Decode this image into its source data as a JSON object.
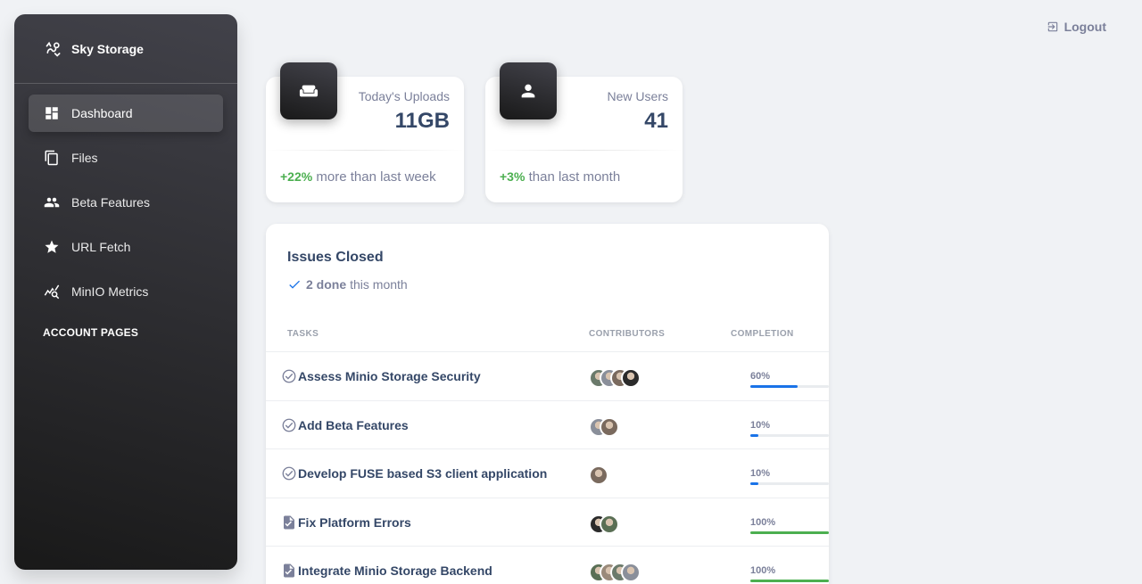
{
  "brand": {
    "name": "Sky Storage"
  },
  "sidebar": {
    "items": [
      {
        "label": "Dashboard",
        "icon": "dashboard-icon",
        "active": true
      },
      {
        "label": "Files",
        "icon": "files-icon",
        "active": false
      },
      {
        "label": "Beta Features",
        "icon": "people-icon",
        "active": false
      },
      {
        "label": "URL Fetch",
        "icon": "star-icon",
        "active": false
      },
      {
        "label": "MinIO Metrics",
        "icon": "analytics-icon",
        "active": false
      }
    ],
    "section_title": "ACCOUNT PAGES"
  },
  "header": {
    "logout_label": "Logout"
  },
  "stats": [
    {
      "label": "Today's Uploads",
      "value": "11GB",
      "change": "+22%",
      "change_text": "more than last week",
      "icon": "weekend-icon"
    },
    {
      "label": "New Users",
      "value": "41",
      "change": "+3%",
      "change_text": "than last month",
      "icon": "person-icon"
    }
  ],
  "issues": {
    "title": "Issues Closed",
    "done_count": "2 done",
    "done_suffix": "this month",
    "columns": {
      "tasks": "TASKS",
      "contributors": "CONTRIBUTORS",
      "completion": "COMPLETION"
    },
    "rows": [
      {
        "name": "Assess Minio Storage Security",
        "icon": "check-circle-icon",
        "contributors": 4,
        "completion_label": "60%",
        "completion": 0.6,
        "color": "#1a73e8"
      },
      {
        "name": "Add Beta Features",
        "icon": "check-circle-icon",
        "contributors": 2,
        "completion_label": "10%",
        "completion": 0.1,
        "color": "#1a73e8"
      },
      {
        "name": "Develop FUSE based S3 client application",
        "icon": "check-circle-icon",
        "contributors": 1,
        "completion_label": "10%",
        "completion": 0.1,
        "color": "#1a73e8"
      },
      {
        "name": "Fix Platform Errors",
        "icon": "assignment-icon",
        "contributors": 2,
        "completion_label": "100%",
        "completion": 1.0,
        "color": "#4caf50"
      },
      {
        "name": "Integrate Minio Storage Backend",
        "icon": "assignment-icon",
        "contributors": 4,
        "completion_label": "100%",
        "completion": 1.0,
        "color": "#4caf50"
      }
    ]
  },
  "colors": {
    "accent": "#1a73e8",
    "success": "#4caf50",
    "text": "#344767",
    "muted": "#7b809a"
  }
}
